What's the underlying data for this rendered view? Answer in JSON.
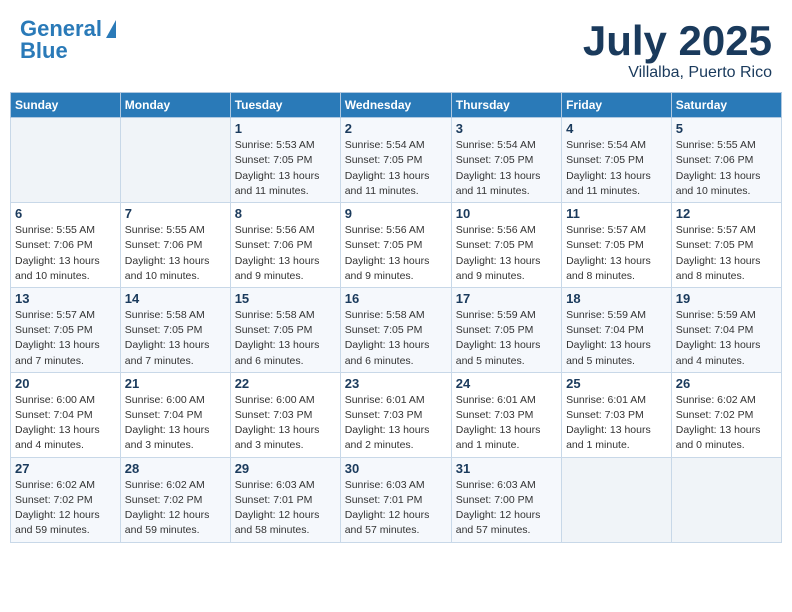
{
  "header": {
    "logo_line1": "General",
    "logo_line2": "Blue",
    "month": "July 2025",
    "location": "Villalba, Puerto Rico"
  },
  "weekdays": [
    "Sunday",
    "Monday",
    "Tuesday",
    "Wednesday",
    "Thursday",
    "Friday",
    "Saturday"
  ],
  "weeks": [
    [
      {
        "day": "",
        "detail": ""
      },
      {
        "day": "",
        "detail": ""
      },
      {
        "day": "1",
        "detail": "Sunrise: 5:53 AM\nSunset: 7:05 PM\nDaylight: 13 hours and 11 minutes."
      },
      {
        "day": "2",
        "detail": "Sunrise: 5:54 AM\nSunset: 7:05 PM\nDaylight: 13 hours and 11 minutes."
      },
      {
        "day": "3",
        "detail": "Sunrise: 5:54 AM\nSunset: 7:05 PM\nDaylight: 13 hours and 11 minutes."
      },
      {
        "day": "4",
        "detail": "Sunrise: 5:54 AM\nSunset: 7:05 PM\nDaylight: 13 hours and 11 minutes."
      },
      {
        "day": "5",
        "detail": "Sunrise: 5:55 AM\nSunset: 7:06 PM\nDaylight: 13 hours and 10 minutes."
      }
    ],
    [
      {
        "day": "6",
        "detail": "Sunrise: 5:55 AM\nSunset: 7:06 PM\nDaylight: 13 hours and 10 minutes."
      },
      {
        "day": "7",
        "detail": "Sunrise: 5:55 AM\nSunset: 7:06 PM\nDaylight: 13 hours and 10 minutes."
      },
      {
        "day": "8",
        "detail": "Sunrise: 5:56 AM\nSunset: 7:06 PM\nDaylight: 13 hours and 9 minutes."
      },
      {
        "day": "9",
        "detail": "Sunrise: 5:56 AM\nSunset: 7:05 PM\nDaylight: 13 hours and 9 minutes."
      },
      {
        "day": "10",
        "detail": "Sunrise: 5:56 AM\nSunset: 7:05 PM\nDaylight: 13 hours and 9 minutes."
      },
      {
        "day": "11",
        "detail": "Sunrise: 5:57 AM\nSunset: 7:05 PM\nDaylight: 13 hours and 8 minutes."
      },
      {
        "day": "12",
        "detail": "Sunrise: 5:57 AM\nSunset: 7:05 PM\nDaylight: 13 hours and 8 minutes."
      }
    ],
    [
      {
        "day": "13",
        "detail": "Sunrise: 5:57 AM\nSunset: 7:05 PM\nDaylight: 13 hours and 7 minutes."
      },
      {
        "day": "14",
        "detail": "Sunrise: 5:58 AM\nSunset: 7:05 PM\nDaylight: 13 hours and 7 minutes."
      },
      {
        "day": "15",
        "detail": "Sunrise: 5:58 AM\nSunset: 7:05 PM\nDaylight: 13 hours and 6 minutes."
      },
      {
        "day": "16",
        "detail": "Sunrise: 5:58 AM\nSunset: 7:05 PM\nDaylight: 13 hours and 6 minutes."
      },
      {
        "day": "17",
        "detail": "Sunrise: 5:59 AM\nSunset: 7:05 PM\nDaylight: 13 hours and 5 minutes."
      },
      {
        "day": "18",
        "detail": "Sunrise: 5:59 AM\nSunset: 7:04 PM\nDaylight: 13 hours and 5 minutes."
      },
      {
        "day": "19",
        "detail": "Sunrise: 5:59 AM\nSunset: 7:04 PM\nDaylight: 13 hours and 4 minutes."
      }
    ],
    [
      {
        "day": "20",
        "detail": "Sunrise: 6:00 AM\nSunset: 7:04 PM\nDaylight: 13 hours and 4 minutes."
      },
      {
        "day": "21",
        "detail": "Sunrise: 6:00 AM\nSunset: 7:04 PM\nDaylight: 13 hours and 3 minutes."
      },
      {
        "day": "22",
        "detail": "Sunrise: 6:00 AM\nSunset: 7:03 PM\nDaylight: 13 hours and 3 minutes."
      },
      {
        "day": "23",
        "detail": "Sunrise: 6:01 AM\nSunset: 7:03 PM\nDaylight: 13 hours and 2 minutes."
      },
      {
        "day": "24",
        "detail": "Sunrise: 6:01 AM\nSunset: 7:03 PM\nDaylight: 13 hours and 1 minute."
      },
      {
        "day": "25",
        "detail": "Sunrise: 6:01 AM\nSunset: 7:03 PM\nDaylight: 13 hours and 1 minute."
      },
      {
        "day": "26",
        "detail": "Sunrise: 6:02 AM\nSunset: 7:02 PM\nDaylight: 13 hours and 0 minutes."
      }
    ],
    [
      {
        "day": "27",
        "detail": "Sunrise: 6:02 AM\nSunset: 7:02 PM\nDaylight: 12 hours and 59 minutes."
      },
      {
        "day": "28",
        "detail": "Sunrise: 6:02 AM\nSunset: 7:02 PM\nDaylight: 12 hours and 59 minutes."
      },
      {
        "day": "29",
        "detail": "Sunrise: 6:03 AM\nSunset: 7:01 PM\nDaylight: 12 hours and 58 minutes."
      },
      {
        "day": "30",
        "detail": "Sunrise: 6:03 AM\nSunset: 7:01 PM\nDaylight: 12 hours and 57 minutes."
      },
      {
        "day": "31",
        "detail": "Sunrise: 6:03 AM\nSunset: 7:00 PM\nDaylight: 12 hours and 57 minutes."
      },
      {
        "day": "",
        "detail": ""
      },
      {
        "day": "",
        "detail": ""
      }
    ]
  ]
}
